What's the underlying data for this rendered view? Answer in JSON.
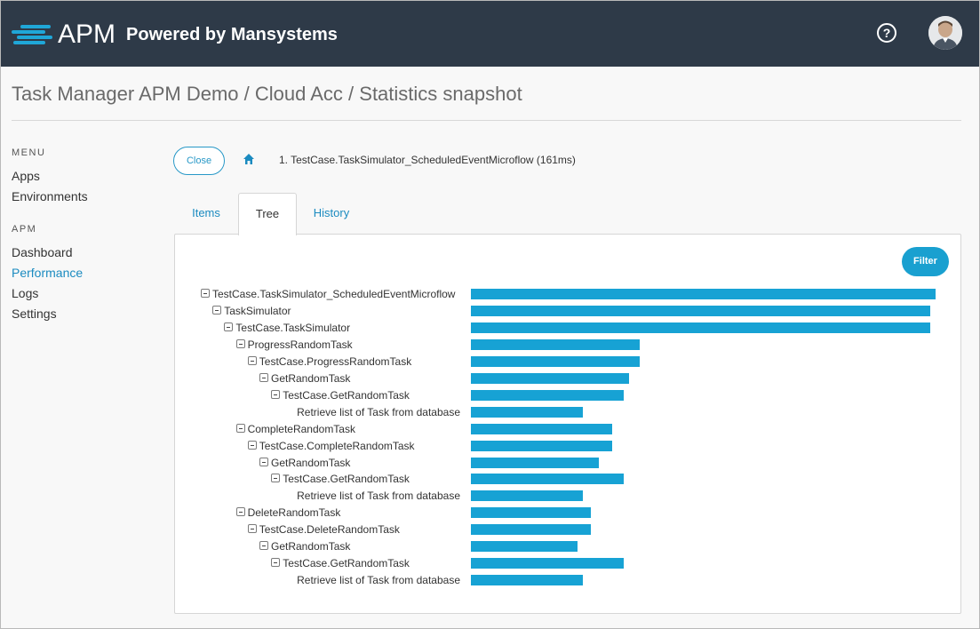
{
  "header": {
    "logo_text": "APM",
    "logo_subtitle": "Powered by Mansystems",
    "help_label": "?"
  },
  "page": {
    "title": "Task Manager APM Demo / Cloud Acc / Statistics snapshot"
  },
  "sidebar": {
    "sections": [
      {
        "heading": "MENU",
        "items": [
          {
            "label": "Apps",
            "active": false
          },
          {
            "label": "Environments",
            "active": false
          }
        ]
      },
      {
        "heading": "APM",
        "items": [
          {
            "label": "Dashboard",
            "active": false
          },
          {
            "label": "Performance",
            "active": true
          },
          {
            "label": "Logs",
            "active": false
          },
          {
            "label": "Settings",
            "active": false
          }
        ]
      }
    ]
  },
  "toolbar": {
    "close_label": "Close",
    "breadcrumb_text": "1. TestCase.TaskSimulator_ScheduledEventMicroflow (161ms)"
  },
  "tabs": [
    {
      "label": "Items",
      "active": false
    },
    {
      "label": "Tree",
      "active": true
    },
    {
      "label": "History",
      "active": false
    }
  ],
  "filter_label": "Filter",
  "colors": {
    "accent": "#19a0d0",
    "topbar": "#2e3a48",
    "bar": "#17a2d4"
  },
  "tree": [
    {
      "label": "TestCase.TaskSimulator_ScheduledEventMicroflow",
      "depth": 0,
      "toggle": true,
      "fraction": 1.0
    },
    {
      "label": "TaskSimulator",
      "depth": 1,
      "toggle": true,
      "fraction": 0.989
    },
    {
      "label": "TestCase.TaskSimulator",
      "depth": 2,
      "toggle": true,
      "fraction": 0.989
    },
    {
      "label": "ProgressRandomTask",
      "depth": 3,
      "toggle": true,
      "fraction": 0.363
    },
    {
      "label": "TestCase.ProgressRandomTask",
      "depth": 4,
      "toggle": true,
      "fraction": 0.363
    },
    {
      "label": "GetRandomTask",
      "depth": 5,
      "toggle": true,
      "fraction": 0.34
    },
    {
      "label": "TestCase.GetRandomTask",
      "depth": 6,
      "toggle": true,
      "fraction": 0.329
    },
    {
      "label": "Retrieve list of Task from database",
      "depth": 7,
      "toggle": false,
      "fraction": 0.241
    },
    {
      "label": "CompleteRandomTask",
      "depth": 3,
      "toggle": true,
      "fraction": 0.304
    },
    {
      "label": "TestCase.CompleteRandomTask",
      "depth": 4,
      "toggle": true,
      "fraction": 0.304
    },
    {
      "label": "GetRandomTask",
      "depth": 5,
      "toggle": true,
      "fraction": 0.275
    },
    {
      "label": "TestCase.GetRandomTask",
      "depth": 6,
      "toggle": true,
      "fraction": 0.329
    },
    {
      "label": "Retrieve list of Task from database",
      "depth": 7,
      "toggle": false,
      "fraction": 0.241
    },
    {
      "label": "DeleteRandomTask",
      "depth": 3,
      "toggle": true,
      "fraction": 0.258
    },
    {
      "label": "TestCase.DeleteRandomTask",
      "depth": 4,
      "toggle": true,
      "fraction": 0.258
    },
    {
      "label": "GetRandomTask",
      "depth": 5,
      "toggle": true,
      "fraction": 0.229
    },
    {
      "label": "TestCase.GetRandomTask",
      "depth": 6,
      "toggle": true,
      "fraction": 0.329
    },
    {
      "label": "Retrieve list of Task from database",
      "depth": 7,
      "toggle": false,
      "fraction": 0.241
    }
  ]
}
